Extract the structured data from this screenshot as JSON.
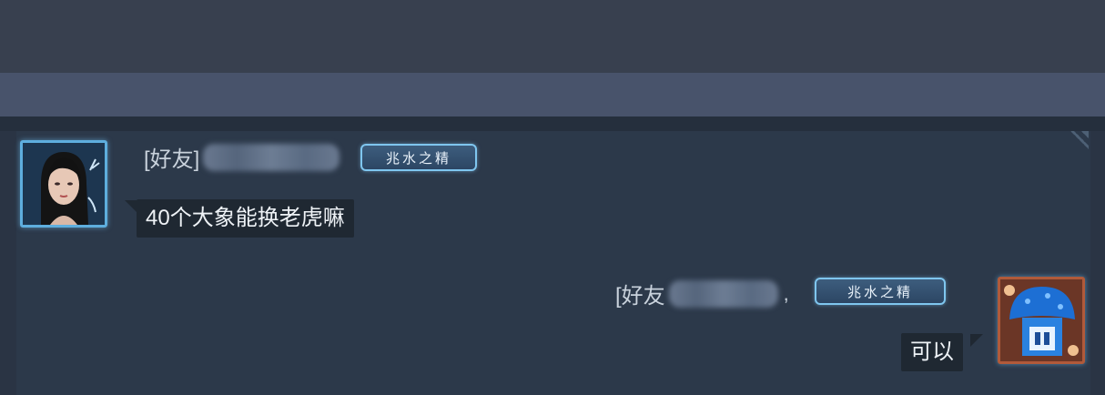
{
  "chat": {
    "messages": [
      {
        "prefix": "[好友]",
        "badge": "兆水之精",
        "text": "40个大象能换老虎嘛",
        "avatar_icon": "female-character-avatar"
      },
      {
        "prefix": "[好友",
        "separator": ",",
        "badge": "兆水之精",
        "text": "可以",
        "avatar_icon": "blue-mushroom-avatar"
      }
    ]
  }
}
